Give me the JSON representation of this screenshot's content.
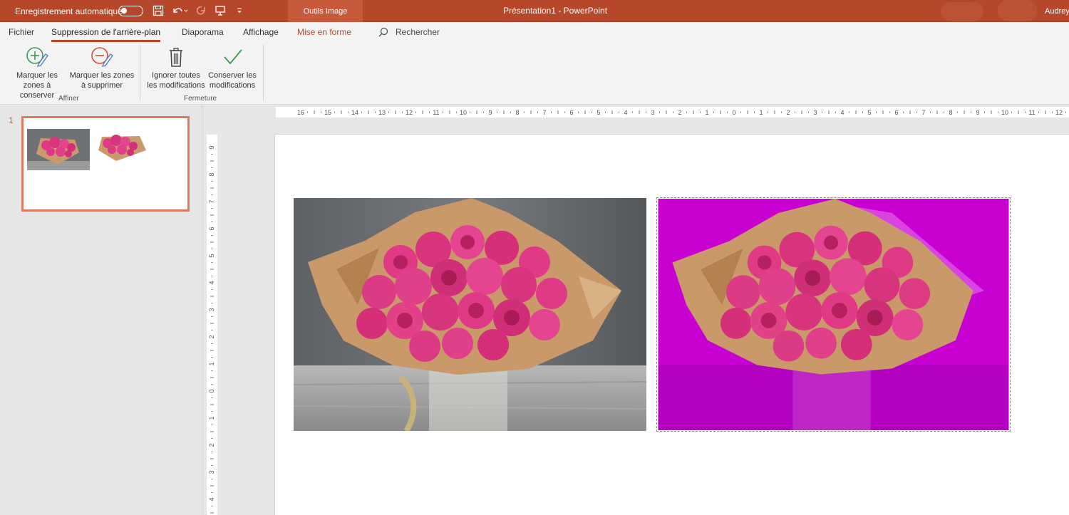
{
  "titlebar": {
    "autosave_label": "Enregistrement automatique",
    "context_tab": "Outils Image",
    "document_title": "Présentation1  -  PowerPoint",
    "user": "Audrey",
    "accent": "#b7472a"
  },
  "tabs": {
    "file": "Fichier",
    "background_removal": "Suppression de l'arrière-plan",
    "slideshow": "Diaporama",
    "view": "Affichage",
    "format": "Mise en forme",
    "search": "Rechercher"
  },
  "ribbon": {
    "mark_keep": "Marquer les\nzones à conserver",
    "mark_remove": "Marquer les zones\nà supprimer",
    "discard_all": "Ignorer toutes\nles modifications",
    "keep_changes": "Conserver les\nmodifications",
    "group_refine": "Affiner",
    "group_close": "Fermeture"
  },
  "thumbnails": {
    "slide_number": "1"
  },
  "ruler": {
    "horizontal_labels": [
      "16",
      "15",
      "14",
      "13",
      "12",
      "11",
      "10",
      "9",
      "8",
      "7",
      "6",
      "5",
      "4",
      "3",
      "2",
      "1",
      "0",
      "1",
      "2",
      "3",
      "4",
      "5",
      "6",
      "7",
      "8",
      "9",
      "10",
      "11",
      "12"
    ],
    "vertical_labels": [
      "9",
      "8",
      "7",
      "6",
      "5",
      "4",
      "3",
      "2",
      "1",
      "0",
      "1",
      "2",
      "3",
      "4"
    ]
  },
  "colors": {
    "removal_overlay": "#c800d2",
    "rose": "#e03a86",
    "paper": "#c79a6a"
  },
  "icons": {
    "save": "save-icon",
    "undo": "undo-icon",
    "redo": "redo-icon",
    "present": "present-icon",
    "customize": "customize-icon",
    "search": "search-icon",
    "mark_keep": "pencil-plus-icon",
    "mark_remove": "pencil-minus-icon",
    "discard": "trash-icon",
    "keep": "checkmark-icon"
  }
}
